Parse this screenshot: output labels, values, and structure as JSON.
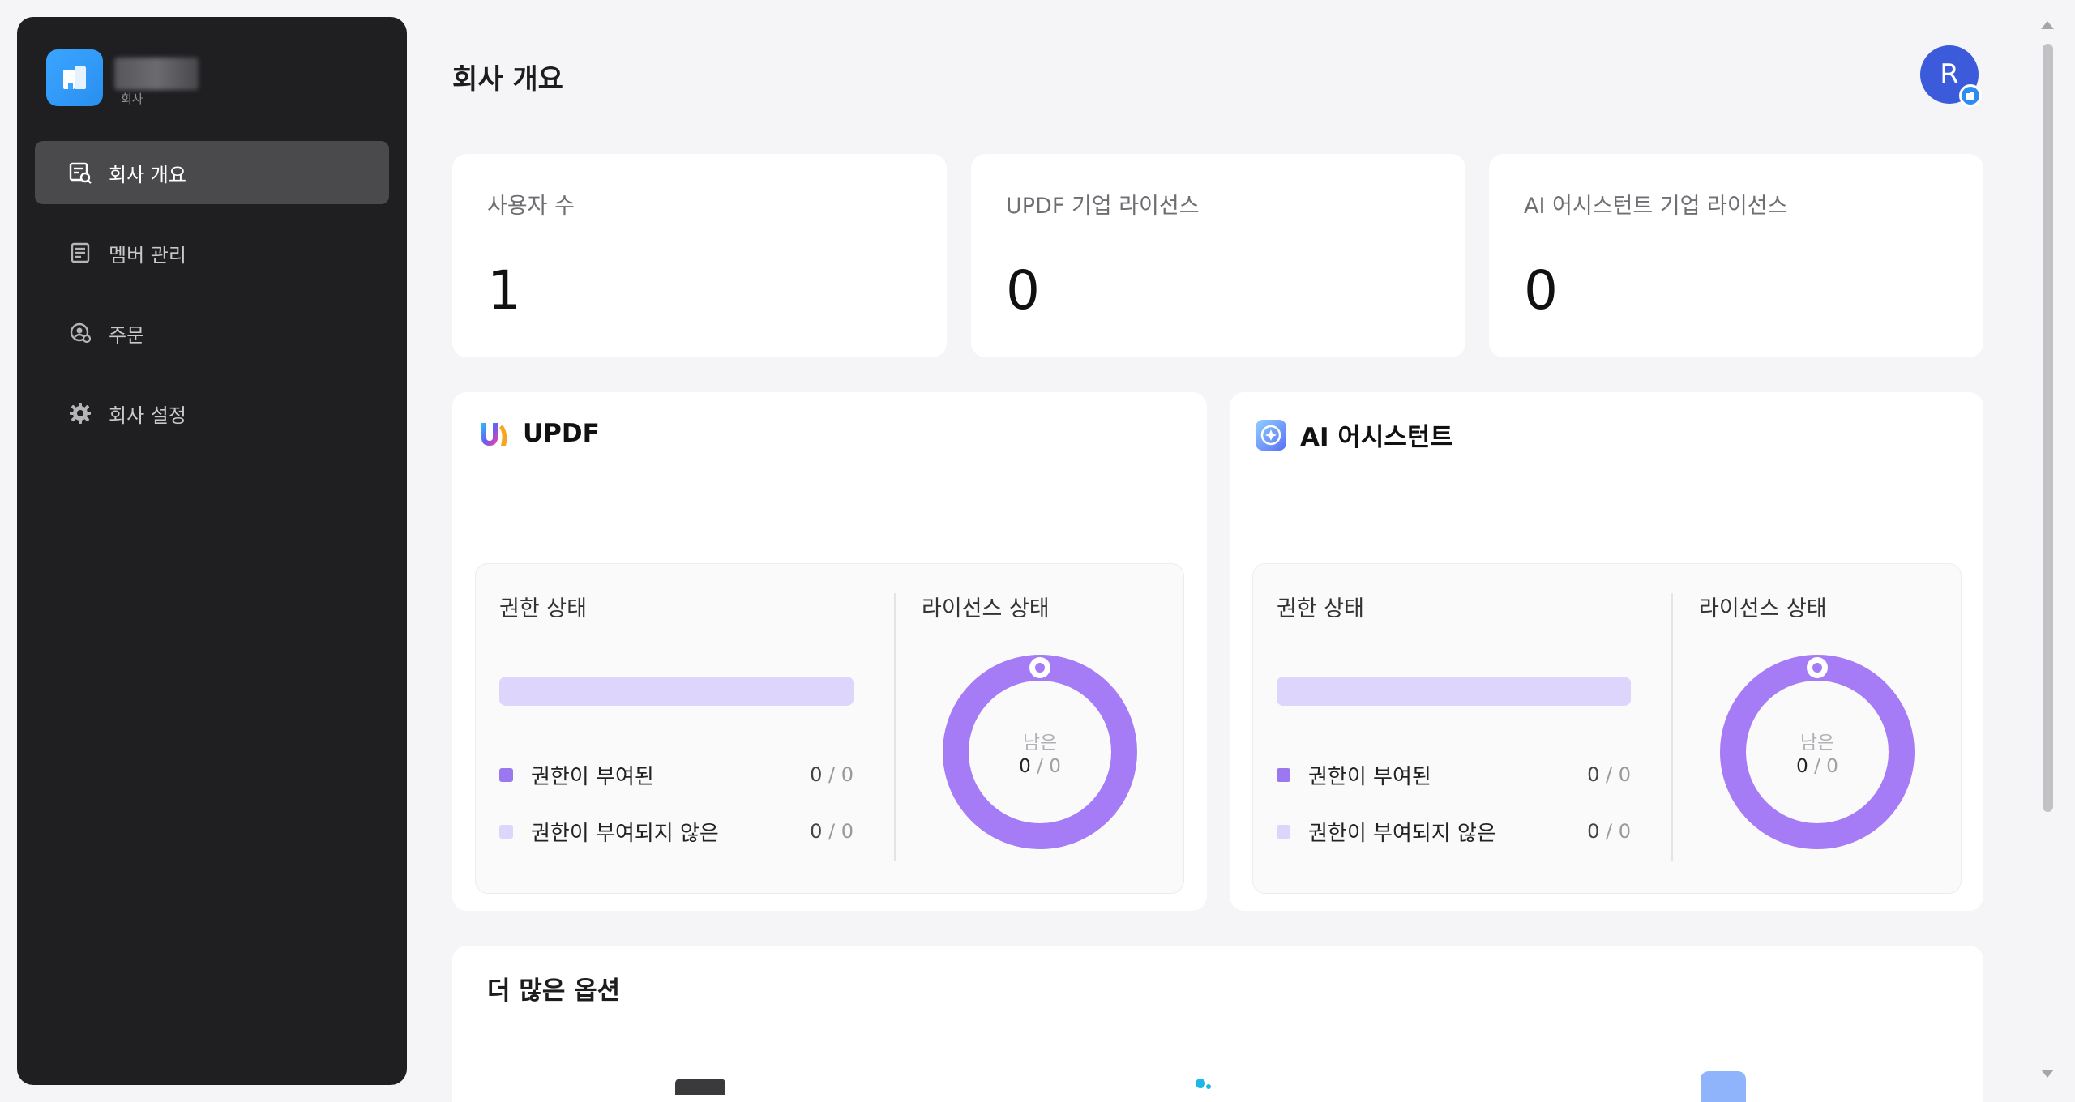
{
  "sidebar": {
    "brand_sub": "회사",
    "items": [
      {
        "label": "회사 개요",
        "icon": "company-overview-icon",
        "active": true
      },
      {
        "label": "멤버 관리",
        "icon": "member-list-icon"
      },
      {
        "label": "주문",
        "icon": "order-icon"
      },
      {
        "label": "회사 설정",
        "icon": "gear-icon"
      }
    ]
  },
  "header": {
    "title": "회사 개요",
    "avatar_initial": "R"
  },
  "stats": [
    {
      "label": "사용자 수",
      "value": "1"
    },
    {
      "label": "UPDF 기업 라이선스",
      "value": "0"
    },
    {
      "label": "AI 어시스턴트 기업 라이선스",
      "value": "0"
    }
  ],
  "products": [
    {
      "name": "UPDF",
      "icon": "updf-logo-icon",
      "permission_title": "권한 상태",
      "license_title": "라이선스 상태",
      "granted_label": "권한이 부여된",
      "granted_used": "0",
      "granted_total": "0",
      "not_granted_label": "권한이 부여되지 않은",
      "not_granted_used": "0",
      "not_granted_total": "0",
      "remaining_label": "남은",
      "remaining_used": "0",
      "remaining_total": "0"
    },
    {
      "name": "AI 어시스턴트",
      "icon": "ai-assistant-icon",
      "permission_title": "권한 상태",
      "license_title": "라이선스 상태",
      "granted_label": "권한이 부여된",
      "granted_used": "0",
      "granted_total": "0",
      "not_granted_label": "권한이 부여되지 않은",
      "not_granted_used": "0",
      "not_granted_total": "0",
      "remaining_label": "남은",
      "remaining_used": "0",
      "remaining_total": "0"
    }
  ],
  "more": {
    "title": "더 많은 옵션"
  },
  "colors": {
    "sidebar_bg": "#1f1f21",
    "active_item": "#4a4a4d",
    "granted": "#9b78f0",
    "not_granted": "#ddd5fb",
    "donut": "#a57cf5",
    "avatar": "#3b5bdb"
  }
}
